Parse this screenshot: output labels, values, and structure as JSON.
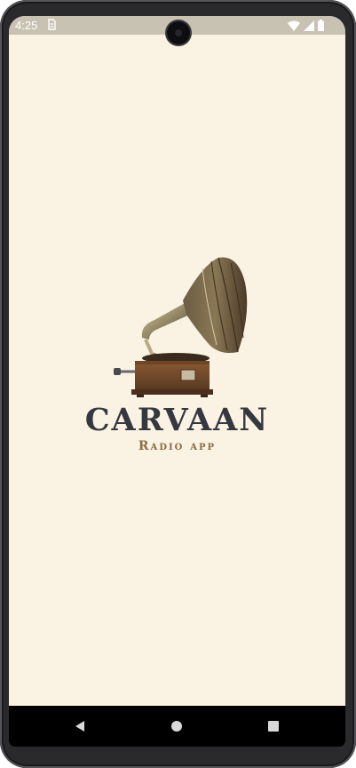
{
  "status_bar": {
    "time": "4:25",
    "icons": [
      "sim-card-icon",
      "wifi-icon",
      "cell-signal-icon",
      "battery-icon"
    ]
  },
  "splash": {
    "logo_icon": "gramophone-icon",
    "title": "CARVAAN",
    "subtitle": "Radio app"
  },
  "nav_bar": {
    "buttons": [
      "back",
      "home",
      "recents"
    ]
  },
  "colors": {
    "background": "#faf2e3",
    "title": "#353840",
    "subtitle": "#8a6d45",
    "status_bar": "#c8c2b3"
  }
}
